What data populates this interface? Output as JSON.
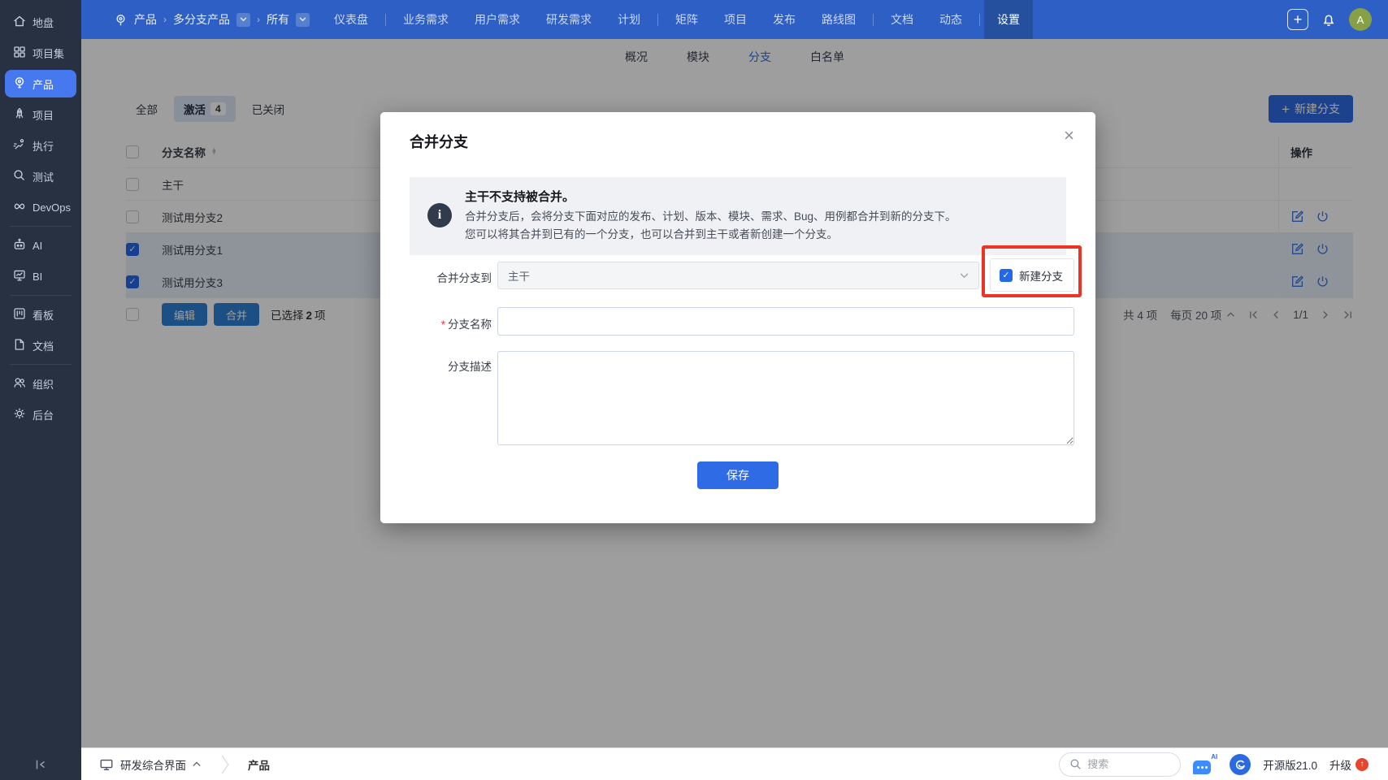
{
  "colors": {
    "topbar": "#2d5fc4",
    "sidebar": "#283142",
    "accent": "#2e6fe4",
    "annotation_red": "#e93525",
    "avatar_bg": "#87a045",
    "selected_row": "#e7effb"
  },
  "sidebar": {
    "items": [
      {
        "label": "地盘",
        "icon": "home-icon",
        "active": false
      },
      {
        "label": "项目集",
        "icon": "program-grid-icon",
        "active": false
      },
      {
        "label": "产品",
        "icon": "product-bulb-icon",
        "active": true
      },
      {
        "label": "项目",
        "icon": "project-rocket-icon",
        "active": false
      },
      {
        "label": "执行",
        "icon": "execution-runner-icon",
        "active": false
      },
      {
        "label": "测试",
        "icon": "qa-magnifier-icon",
        "active": false
      },
      {
        "label": "DevOps",
        "icon": "devops-infinity-icon",
        "active": false
      },
      {
        "label": "AI",
        "icon": "ai-robot-icon",
        "active": false
      },
      {
        "label": "BI",
        "icon": "bi-board-icon",
        "active": false
      },
      {
        "label": "看板",
        "icon": "kanban-icon",
        "active": false
      },
      {
        "label": "文档",
        "icon": "doc-file-icon",
        "active": false
      },
      {
        "label": "组织",
        "icon": "org-users-icon",
        "active": false
      },
      {
        "label": "后台",
        "icon": "admin-gear-icon",
        "active": false
      }
    ]
  },
  "topbar": {
    "breadcrumb": {
      "root": "产品",
      "sep": "›",
      "product": "多分支产品",
      "scope": "所有"
    },
    "nav": [
      "仪表盘",
      "业务需求",
      "用户需求",
      "研发需求",
      "计划",
      "矩阵",
      "项目",
      "发布",
      "路线图",
      "文档",
      "动态",
      "设置"
    ],
    "active": "设置",
    "avatar_letter": "A",
    "plus_glyph": "+"
  },
  "subnav": {
    "items": [
      "概况",
      "模块",
      "分支",
      "白名单"
    ],
    "active": "分支"
  },
  "toolbar": {
    "filter_all": "全部",
    "filter_active": "激活",
    "filter_active_count": "4",
    "filter_closed": "已关闭",
    "create_button": "新建分支",
    "plus_glyph": "+"
  },
  "table": {
    "name_header": "分支名称",
    "actions_header": "操作",
    "rows": [
      {
        "name": "主干",
        "checked": false,
        "selected": false,
        "has_actions": false
      },
      {
        "name": "测试用分支2",
        "checked": false,
        "selected": false,
        "has_actions": true
      },
      {
        "name": "测试用分支1",
        "checked": true,
        "selected": true,
        "has_actions": true
      },
      {
        "name": "测试用分支3",
        "checked": true,
        "selected": true,
        "has_actions": true
      }
    ]
  },
  "table_footer": {
    "edit_button": "编辑",
    "merge_button": "合并",
    "selected_prefix": "已选择",
    "selected_count": "2",
    "selected_suffix": "项",
    "total_text": "共 4 项",
    "per_page_text": "每页 20 项",
    "page_indicator": "1/1"
  },
  "modal": {
    "title": "合并分支",
    "close_glyph": "×",
    "alert": {
      "title": "主干不支持被合并。",
      "line1": "合并分支后，会将分支下面对应的发布、计划、版本、模块、需求、Bug、用例都合并到新的分支下。",
      "line2": "您可以将其合并到已有的一个分支，也可以合并到主干或者新创建一个分支。",
      "icon_glyph": "i"
    },
    "merge_to_label": "合并分支到",
    "merge_to_value": "主干",
    "new_branch_checkbox_label": "新建分支",
    "name_label": "分支名称",
    "name_required_mark": "*",
    "name_value": "",
    "desc_label": "分支描述",
    "desc_value": "",
    "save_button": "保存"
  },
  "statusbar": {
    "view": "研发综合界面",
    "context": "产品",
    "search_placeholder": "搜索",
    "ai_label": "AI",
    "version": "开源版21.0",
    "upgrade": "升级",
    "upgrade_badge_glyph": "↑"
  },
  "glyphs": {
    "check": "✓"
  }
}
